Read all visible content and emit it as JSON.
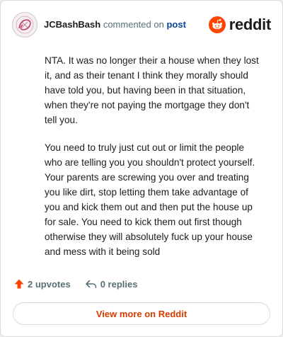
{
  "header": {
    "username": "JCBashBash",
    "action_text": "commented on",
    "post_link": "post",
    "logo_text": "reddit",
    "avatar_icon": "user-avatar",
    "logo_icon": "reddit-snoo-icon"
  },
  "comment": {
    "paragraphs": [
      "NTA. It was no longer their a house when they lost it, and as their tenant I think they morally should have told you, but having been in that situation, when they're not paying the mortgage they don't tell you.",
      "You need to truly just cut out or limit the people who are telling you you shouldn't protect yourself. Your parents are screwing you over and treating you like dirt, stop letting them take advantage of you and kick them out and then put the house up for sale. You need to kick them out first though otherwise they will absolutely fuck up your house and mess with it being sold"
    ]
  },
  "actions": {
    "upvotes": "2 upvotes",
    "replies": "0 replies",
    "upvote_icon": "upvote-arrow-icon",
    "reply_icon": "reply-arrow-icon"
  },
  "footer": {
    "view_more": "View more on Reddit"
  },
  "colors": {
    "brand": "#ff4500",
    "link": "#0a449b",
    "view_more": "#d93a00",
    "muted": "#576f76"
  }
}
